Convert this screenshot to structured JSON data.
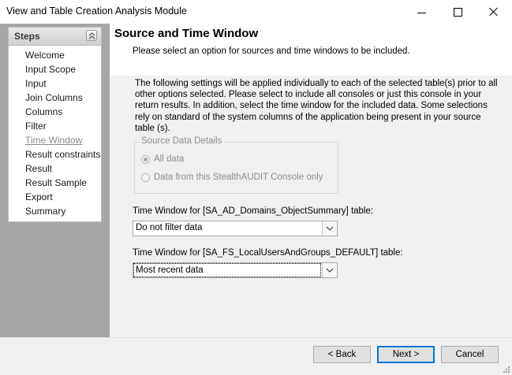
{
  "window": {
    "title": "View and Table Creation Analysis Module"
  },
  "steps": {
    "title": "Steps",
    "current": "Time Window",
    "items": [
      "Welcome",
      "Input Scope",
      "Input",
      "Join Columns",
      "Columns",
      "Filter",
      "Time Window",
      "Result constraints",
      "Result",
      "Result Sample",
      "Export",
      "Summary"
    ]
  },
  "header": {
    "title": "Source and Time Window",
    "subtitle": "Please select an option for sources and time windows to be included."
  },
  "content": {
    "description": "The following settings will be applied individually to each of the selected table(s) prior to all other options selected. Please select to include all consoles or just this console in your return results. In addition, select the time window for the included data. Some selections rely on standard of the system columns of the application being present in your source table (s).",
    "source_group": {
      "legend": "Source Data Details",
      "options": [
        {
          "label": "All data",
          "checked": true
        },
        {
          "label": "Data from this StealthAUDIT Console only",
          "checked": false
        }
      ]
    },
    "time_windows": [
      {
        "label": "Time Window for [SA_AD_Domains_ObjectSummary] table:",
        "value": "Do not filter data"
      },
      {
        "label": "Time Window for [SA_FS_LocalUsersAndGroups_DEFAULT] table:",
        "value": "Most recent data"
      }
    ]
  },
  "footer": {
    "back_label": "< Back",
    "next_label": "Next >",
    "cancel_label": "Cancel"
  },
  "colors": {
    "sidebar_bg": "#a6a6a6",
    "content_bg": "#f0f0f0",
    "default_button_border": "#0078d7",
    "disabled_text": "#8d8d8d"
  }
}
